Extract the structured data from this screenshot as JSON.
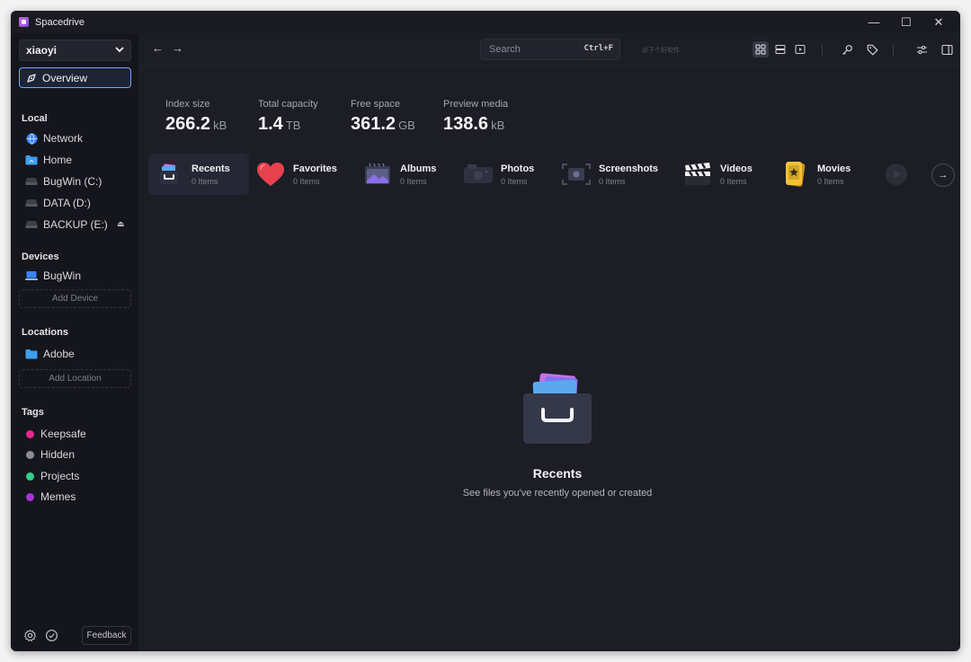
{
  "app": {
    "title": "Spacedrive"
  },
  "window_controls": [
    "—",
    "☐",
    "✕"
  ],
  "sidebar": {
    "library": "xiaoyi",
    "overview": "Overview",
    "local_title": "Local",
    "local_items": [
      {
        "label": "Network",
        "icon": "globe-icon"
      },
      {
        "label": "Home",
        "icon": "home-folder-icon"
      },
      {
        "label": "BugWin (C:)",
        "icon": "drive-icon"
      },
      {
        "label": "DATA (D:)",
        "icon": "drive-icon"
      },
      {
        "label": "BACKUP (E:)",
        "icon": "drive-icon"
      }
    ],
    "devices_title": "Devices",
    "devices": [
      {
        "label": "BugWin",
        "icon": "laptop-icon"
      }
    ],
    "add_device": "Add Device",
    "locations_title": "Locations",
    "locations": [
      {
        "label": "Adobe",
        "icon": "folder-icon"
      }
    ],
    "add_location": "Add Location",
    "tags_title": "Tags",
    "tags": [
      {
        "label": "Keepsafe",
        "color": "#e8268f"
      },
      {
        "label": "Hidden",
        "color": "#8a8b96"
      },
      {
        "label": "Projects",
        "color": "#2fcf8a"
      },
      {
        "label": "Memes",
        "color": "#a734d9"
      }
    ],
    "feedback": "Feedback"
  },
  "topbar": {
    "search_placeholder": "Search",
    "search_shortcut": "Ctrl+F",
    "watermark": "@下个好软件"
  },
  "stats": [
    {
      "label": "Index size",
      "value": "266.2",
      "unit": "kB"
    },
    {
      "label": "Total capacity",
      "value": "1.4",
      "unit": "TB"
    },
    {
      "label": "Free space",
      "value": "361.2",
      "unit": "GB"
    },
    {
      "label": "Preview media",
      "value": "138.6",
      "unit": "kB"
    }
  ],
  "categories": [
    {
      "name": "Recents",
      "count": "0 Items"
    },
    {
      "name": "Favorites",
      "count": "0 Items"
    },
    {
      "name": "Albums",
      "count": "0 Items"
    },
    {
      "name": "Photos",
      "count": "0 Items"
    },
    {
      "name": "Screenshots",
      "count": "0 Items"
    },
    {
      "name": "Videos",
      "count": "0 Items"
    },
    {
      "name": "Movies",
      "count": "0 Items"
    }
  ],
  "empty_state": {
    "title": "Recents",
    "subtitle": "See files you've recently opened or created"
  },
  "colors": {
    "accent": "#6fa8ff",
    "background": "#1c1d25",
    "sidebar": "#15161c"
  }
}
